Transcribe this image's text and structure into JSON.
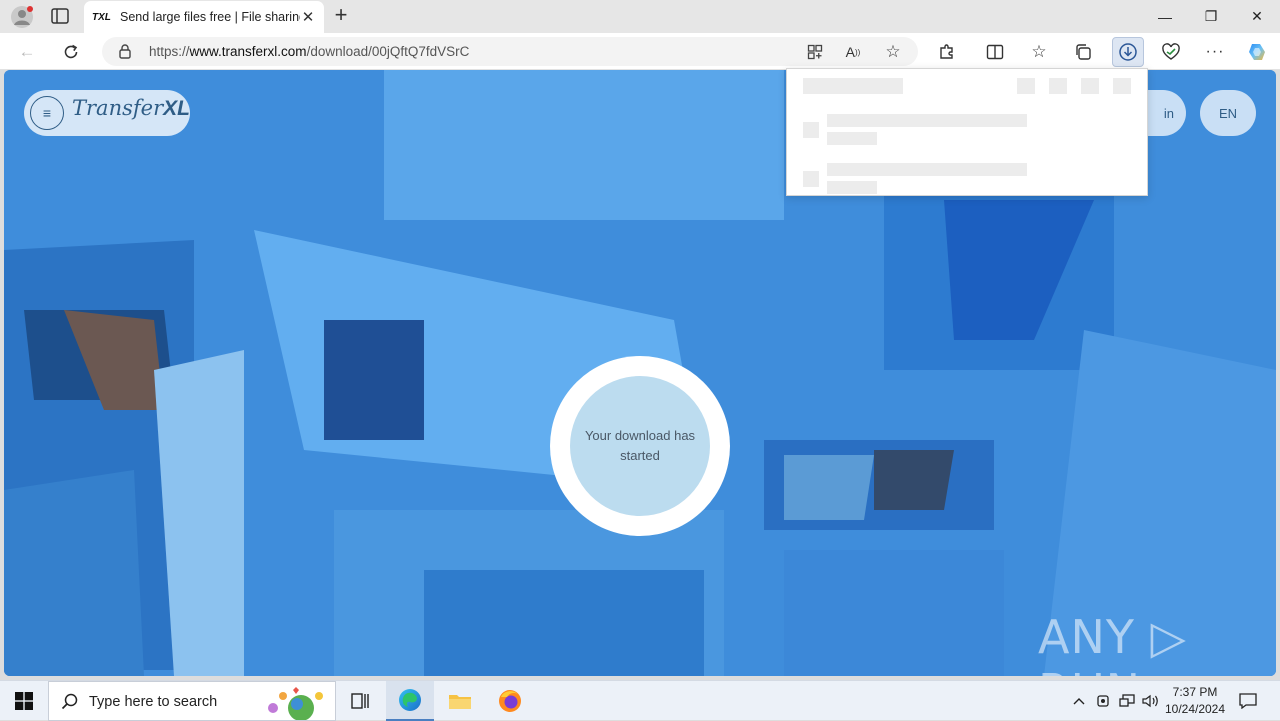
{
  "browser": {
    "tab": {
      "favicon_text": "TXL",
      "title": "Send large files free | File sharing"
    },
    "address": {
      "url_prefix": "https://",
      "url_host": "www.transferxl.com",
      "url_path": "/download/00jQftQ7fdVSrC"
    }
  },
  "page": {
    "logo_light": "Transfer",
    "logo_bold": "XL",
    "signin_label": "in",
    "language_label": "EN",
    "download_status": "Your download has started",
    "watermark": "ANY ▷ RUN"
  },
  "taskbar": {
    "search_placeholder": "Type here to search",
    "time": "7:37 PM",
    "date": "10/24/2024"
  },
  "colors": {
    "page_background": "#3b8ad9",
    "accent": "#2f5d86"
  }
}
